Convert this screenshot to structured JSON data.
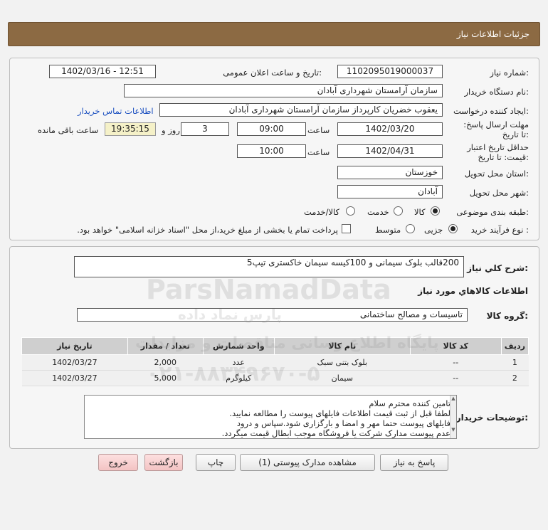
{
  "header": {
    "title": "جزئیات اطلاعات نیاز"
  },
  "form": {
    "need_number_label": "شماره نیاز:",
    "need_number": "1102095019000037",
    "announce_label": "تاریخ و ساعت اعلان عمومی:",
    "announce_value": "1402/03/16 - 12:51",
    "buyer_org_label": "نام دستگاه خریدار:",
    "buyer_org": "سازمان آرامستان شهرداری آبادان",
    "requester_label": "ایجاد کننده درخواست:",
    "requester": "یعقوب خضریان کارپرداز سازمان آرامستان شهرداری آبادان",
    "contact_link": "اطلاعات تماس خریدار",
    "deadline_label": "مهلت ارسال پاسخ: تا تاریخ:",
    "deadline_date": "1402/03/20",
    "time_label": "ساعت",
    "deadline_time": "09:00",
    "days_value": "3",
    "days_and_label": "روز و",
    "remaining_time": "19:35:15",
    "remaining_label": "ساعت باقی مانده",
    "validity_label": "حداقل تاریخ اعتبار قیمت: تا تاریخ:",
    "validity_date": "1402/04/31",
    "validity_time": "10:00",
    "province_label": "استان محل تحویل:",
    "province": "خوزستان",
    "city_label": "شهر محل تحویل:",
    "city": "آبادان",
    "category_label": "طبقه بندی موضوعی:",
    "category_options": [
      "کالا",
      "خدمت",
      "کالا/خدمت"
    ],
    "process_label": "نوع فرآیند خرید :",
    "process_options": [
      "جزیی",
      "متوسط"
    ],
    "payment_note": "پرداخت تمام یا بخشی از مبلغ خرید،از محل \"اسناد خزانه اسلامی\" خواهد بود."
  },
  "summary": {
    "label": "شرح کلي نياز:",
    "value": "200قالب بلوک سیمانی و 100کیسه سیمان خاکستری تیپ5"
  },
  "goods": {
    "section_title": "اطلاعات کالاهاي مورد نياز",
    "group_label": "گروه کالا:",
    "group_value": "تاسیسات و مصالح ساختمانی",
    "headers": [
      "ردیف",
      "کد کالا",
      "نام کالا",
      "واحد شمارش",
      "تعداد / مقدار",
      "تاریخ نیاز"
    ],
    "rows": [
      [
        "1",
        "--",
        "بلوک بتنی سبک",
        "عدد",
        "2,000",
        "1402/03/27"
      ],
      [
        "2",
        "--",
        "سیمان",
        "کیلوگرم",
        "5,000",
        "1402/03/27"
      ]
    ]
  },
  "notes": {
    "label": "توضیحات خریدار:",
    "lines": [
      "تامین کننده محترم سلام",
      "لطفا قبل از ثبت قیمت اطلاعات فایلهای پیوست را مطالعه نمایید.",
      "فایلهای پیوست حتما مهر و امضا و بارگزاری شود.سپاس و درود",
      "عدم پیوست مدارک شرکت یا فروشگاه موجب ابطال قیمت میگردد."
    ]
  },
  "buttons": {
    "reply": "پاسخ به نیاز",
    "view_docs": "مشاهده مدارک پیوستی (1)",
    "print": "چاپ",
    "back": "بازگشت",
    "exit": "خروج"
  },
  "watermark": {
    "brand": "ParsNamadData",
    "line1": "پایگاه اطلاع رسانی مناقصات و مزایدات",
    "line2": "۰۲۱-۸۸۳۴۹۶۷۰-۵",
    "line3": "پارس نماد داده"
  }
}
